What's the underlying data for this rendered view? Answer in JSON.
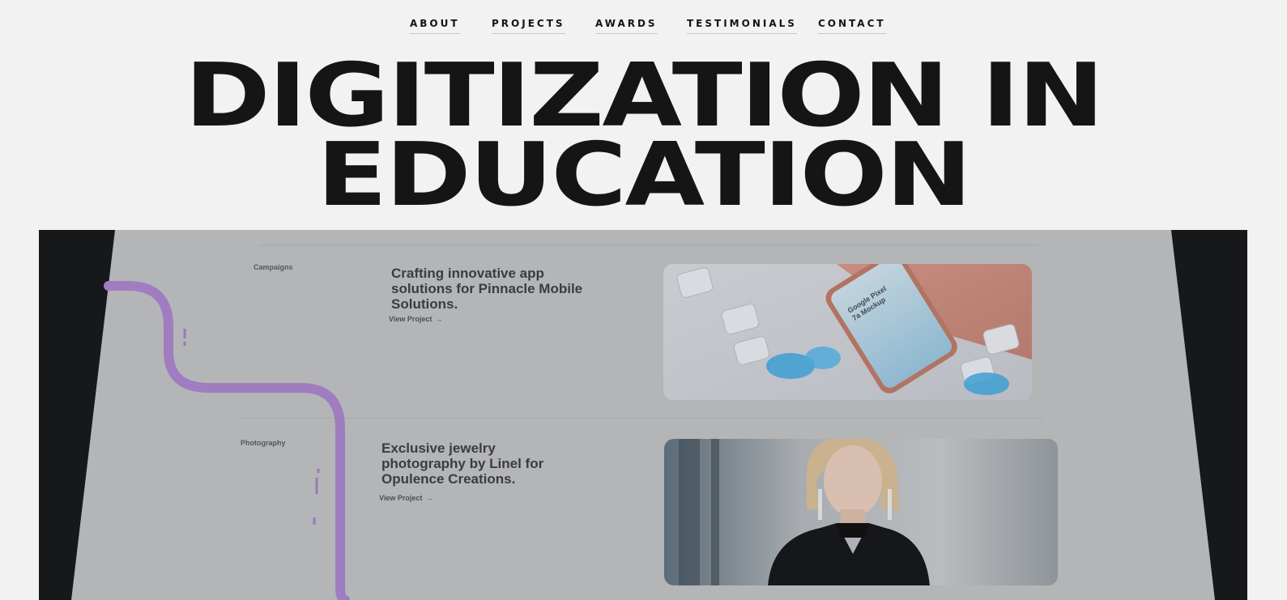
{
  "nav": {
    "items": [
      {
        "label": "ABOUT"
      },
      {
        "label": "PROJECTS"
      },
      {
        "label": "AWARDS"
      },
      {
        "label": "TESTIMONIALS"
      },
      {
        "label": "CONTACT"
      }
    ]
  },
  "hero": {
    "line1": "DIGITIZATION IN",
    "line2": "EDUCATION"
  },
  "showcase": {
    "projects": [
      {
        "category": "Campaigns",
        "title_lines": [
          "Crafting innovative app",
          "solutions for Pinnacle Mobile",
          "Solutions."
        ],
        "link": "View Project",
        "link_icon": "arrow-down-right-icon",
        "image": "phone-mockup-image",
        "image_text": "Google Pixel 7a Mockup"
      },
      {
        "category": "Photography",
        "title_lines": [
          "Exclusive jewelry",
          "photography by Linel for",
          "Opulence Creations."
        ],
        "link": "View Project",
        "link_icon": "arrow-down-right-icon",
        "image": "jewelry-model-photo"
      }
    ]
  },
  "colors": {
    "page_bg": "#f2f2f2",
    "text": "#141414",
    "frame_bg": "#17181a",
    "screen_bg": "#b4b5b7",
    "accent_line": "#a07cc0"
  }
}
